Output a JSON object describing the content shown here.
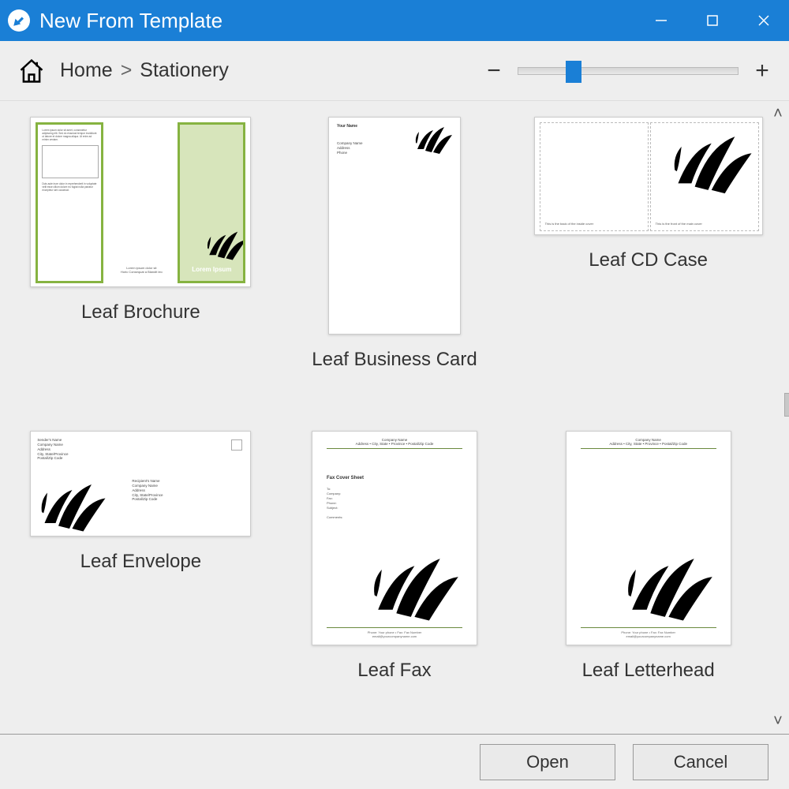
{
  "titlebar": {
    "title": "New From Template"
  },
  "toolbar": {
    "breadcrumb": [
      "Home",
      "Stationery"
    ],
    "zoom_minus": "−",
    "zoom_plus": "+"
  },
  "templates": [
    {
      "id": "leaf-brochure",
      "label": "Leaf Brochure"
    },
    {
      "id": "leaf-business-card",
      "label": "Leaf Business Card"
    },
    {
      "id": "leaf-cd-case",
      "label": "Leaf CD Case"
    },
    {
      "id": "leaf-envelope",
      "label": "Leaf Envelope"
    },
    {
      "id": "leaf-fax",
      "label": "Leaf Fax"
    },
    {
      "id": "leaf-letterhead",
      "label": "Leaf Letterhead"
    }
  ],
  "buttons": {
    "open": "Open",
    "cancel": "Cancel"
  },
  "thumb_strings": {
    "lorem": "Lorem Ipsum",
    "brochure_mid": "Lorem ipsum dolor sit\nHoric Consequat a Blandit leo",
    "bizcard_name": "Your Name",
    "bizcard_company": "Company Name\nAddress\nPhone",
    "cd_left": "This is the back of the inside cover",
    "cd_right": "This is the front of the main cover",
    "env_sender": "Sender's Name\nCompany Name\nAddress\nCity, State/Province\nPostal/Zip Code",
    "env_recip": "Recipient's Name\nCompany Name\nAddress\nCity, State/Province\nPostal/Zip Code",
    "fax_title": "Fax Cover Sheet",
    "fax_fields": "To:\nCompany:\nFax:\nPhone:\nSubject:\n\nComments:",
    "page_header": "Company Name\nAddress • City, State • Province • Postal/Zip Code",
    "page_footer": "Phone: Your phone • Fax: Fax Number\nemail@yourcompanyname.com"
  }
}
